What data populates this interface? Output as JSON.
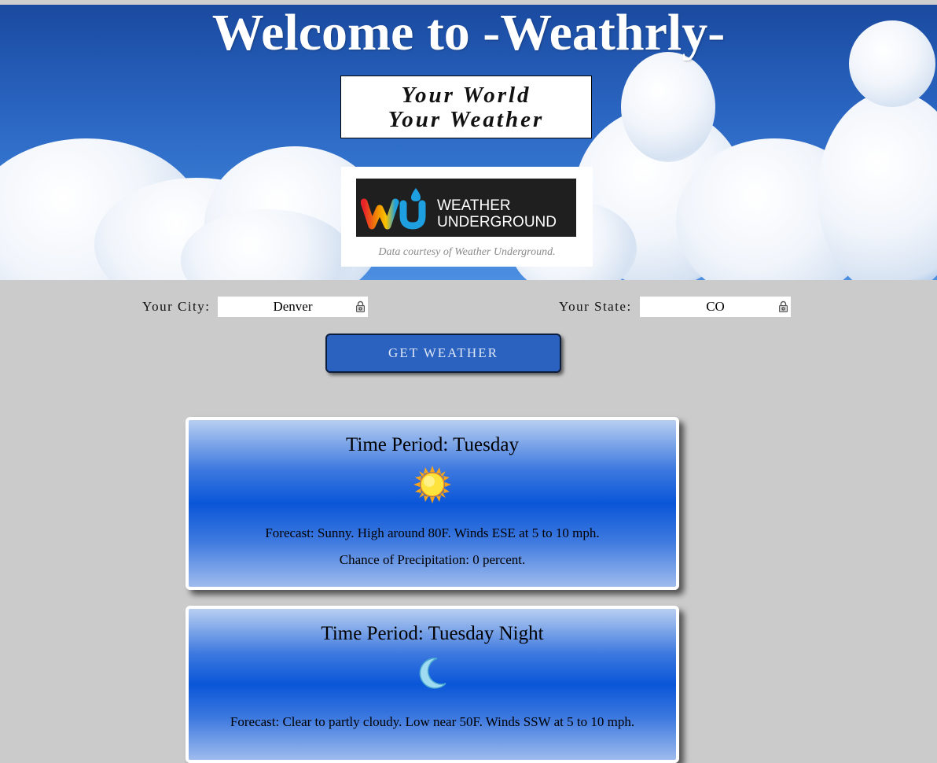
{
  "header": {
    "title": "Welcome to -Weathrly-",
    "tagline_line1": "Your World",
    "tagline_line2": "Your Weather"
  },
  "wu_badge": {
    "logo_line1": "WEATHER",
    "logo_line2": "UNDERGROUND",
    "logo_mark": "wu",
    "credit": "Data courtesy of Weather Underground."
  },
  "form": {
    "city_label": "Your City:",
    "city_value": "Denver",
    "state_label": "Your State:",
    "state_value": "CO",
    "submit_label": "GET WEATHER"
  },
  "forecast": [
    {
      "title": "Time Period: Tuesday",
      "icon": "sun-icon",
      "forecast": "Forecast: Sunny. High around 80F. Winds ESE at 5 to 10 mph.",
      "precip": "Chance of Precipitation: 0 percent."
    },
    {
      "title": "Time Period: Tuesday Night",
      "icon": "moon-icon",
      "forecast": "Forecast: Clear to partly cloudy. Low near 50F. Winds SSW at 5 to 10 mph."
    }
  ],
  "colors": {
    "page_bg": "#cbcbcb",
    "button_bg": "#2b62c0",
    "card_mid": "#0a56d8"
  }
}
